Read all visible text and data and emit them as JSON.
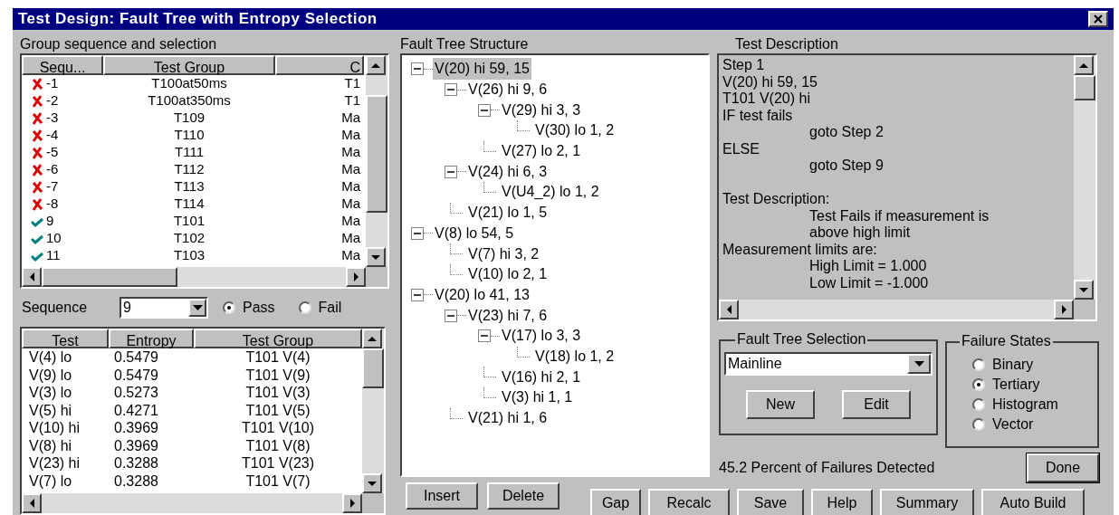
{
  "window": {
    "title": "Test Design: Fault Tree with Entropy Selection"
  },
  "group_panel": {
    "label": "Group sequence and selection",
    "columns": [
      "Sequ...",
      "Test Group",
      "C"
    ],
    "rows": [
      {
        "kind": "fail",
        "sequence": "-1",
        "test_group": "T100at50ms",
        "column_3": "T1",
        "selected": false
      },
      {
        "kind": "fail",
        "sequence": "-2",
        "test_group": "T100at350ms",
        "column_3": "T1",
        "selected": false
      },
      {
        "kind": "fail",
        "sequence": "-3",
        "test_group": "T109",
        "column_3": "Ma",
        "selected": false
      },
      {
        "kind": "fail",
        "sequence": "-4",
        "test_group": "T110",
        "column_3": "Ma",
        "selected": false
      },
      {
        "kind": "fail",
        "sequence": "-5",
        "test_group": "T111",
        "column_3": "Ma",
        "selected": false
      },
      {
        "kind": "fail",
        "sequence": "-6",
        "test_group": "T112",
        "column_3": "Ma",
        "selected": false
      },
      {
        "kind": "fail",
        "sequence": "-7",
        "test_group": "T113",
        "column_3": "Ma",
        "selected": false
      },
      {
        "kind": "fail",
        "sequence": "-8",
        "test_group": "T114",
        "column_3": "Ma",
        "selected": false
      },
      {
        "kind": "pass",
        "sequence": "9",
        "test_group": "T101",
        "column_3": "Ma",
        "selected": false
      },
      {
        "kind": "pass",
        "sequence": "10",
        "test_group": "T102",
        "column_3": "Ma",
        "selected": false
      },
      {
        "kind": "pass",
        "sequence": "11",
        "test_group": "T103",
        "column_3": "Ma",
        "selected": false
      }
    ]
  },
  "sequence": {
    "label": "Sequence",
    "value": "9",
    "options": [
      {
        "label": "Pass",
        "selected": true
      },
      {
        "label": "Fail",
        "selected": false
      }
    ]
  },
  "entropy_table": {
    "columns": [
      "Test",
      "Entropy",
      "Test Group"
    ],
    "rows": [
      {
        "test": "V(4) lo",
        "entropy": "0.5479",
        "test_group": "T101 V(4)"
      },
      {
        "test": "V(9) lo",
        "entropy": "0.5479",
        "test_group": "T101 V(9)"
      },
      {
        "test": "V(3) lo",
        "entropy": "0.5273",
        "test_group": "T101 V(3)"
      },
      {
        "test": "V(5) hi",
        "entropy": "0.4271",
        "test_group": "T101 V(5)"
      },
      {
        "test": "V(10) hi",
        "entropy": "0.3969",
        "test_group": "T101 V(10)"
      },
      {
        "test": "V(8) hi",
        "entropy": "0.3969",
        "test_group": "T101 V(8)"
      },
      {
        "test": "V(23) hi",
        "entropy": "0.3288",
        "test_group": "T101 V(23)"
      },
      {
        "test": "V(7) lo",
        "entropy": "0.3288",
        "test_group": "T101 V(7)"
      }
    ]
  },
  "fault_tree": {
    "label": "Fault Tree Structure",
    "nodes": [
      {
        "label": "V(20) hi  59, 15",
        "selected": true,
        "expanded": true,
        "children": [
          {
            "label": "V(26) hi  9, 6",
            "selected": false,
            "expanded": true,
            "children": [
              {
                "label": "V(29) hi  3, 3",
                "selected": false,
                "expanded": true,
                "children": [
                  {
                    "label": "V(30) lo  1, 2",
                    "selected": false
                  }
                ]
              },
              {
                "label": "V(27) lo  2, 1",
                "selected": false
              }
            ]
          },
          {
            "label": "V(24) hi  6, 3",
            "selected": false,
            "expanded": true,
            "children": [
              {
                "label": "V(U4_2) lo  1, 2",
                "selected": false
              }
            ]
          },
          {
            "label": "V(21) lo  1, 5",
            "selected": false
          }
        ]
      },
      {
        "label": "V(8) lo  54, 5",
        "selected": false,
        "expanded": true,
        "children": [
          {
            "label": "V(7) hi  3, 2",
            "selected": false
          },
          {
            "label": "V(10) lo  2, 1",
            "selected": false
          }
        ]
      },
      {
        "label": "V(20) lo  41, 13",
        "selected": false,
        "expanded": true,
        "children": [
          {
            "label": "V(23) hi  7, 6",
            "selected": false,
            "expanded": true,
            "children": [
              {
                "label": "V(17) lo  3, 3",
                "selected": false,
                "expanded": true,
                "children": [
                  {
                    "label": "V(18) lo  1, 2",
                    "selected": false
                  }
                ]
              },
              {
                "label": "V(16) hi  2, 1",
                "selected": false
              },
              {
                "label": "V(3) hi  1, 1",
                "selected": false
              }
            ]
          },
          {
            "label": "V(21) hi  1, 6",
            "selected": false
          }
        ]
      }
    ]
  },
  "tree_buttons": [
    "Insert",
    "Delete"
  ],
  "description": {
    "label": "Test Description",
    "lines": [
      {
        "text": "Step 1",
        "indented": false,
        "space_before": false
      },
      {
        "text": "V(20) hi  59, 15",
        "indented": false,
        "space_before": false
      },
      {
        "text": "T101 V(20) hi",
        "indented": false,
        "space_before": false
      },
      {
        "text": "IF test fails",
        "indented": false,
        "space_before": false
      },
      {
        "text": "goto Step 2",
        "indented": true,
        "space_before": false
      },
      {
        "text": "ELSE",
        "indented": false,
        "space_before": false
      },
      {
        "text": "goto Step 9",
        "indented": true,
        "space_before": false
      },
      {
        "text": "Test Description:",
        "indented": false,
        "space_before": true
      },
      {
        "text": "Test Fails if measurement is",
        "indented": true,
        "space_before": false
      },
      {
        "text": "above high limit",
        "indented": true,
        "space_before": false
      },
      {
        "text": "Measurement limits are:",
        "indented": false,
        "space_before": false
      },
      {
        "text": "High Limit = 1.000",
        "indented": true,
        "space_before": false
      },
      {
        "text": "Low Limit = -1.000",
        "indented": true,
        "space_before": false
      }
    ]
  },
  "fault_tree_selection": {
    "label": "Fault Tree Selection",
    "value": "Mainline",
    "buttons": [
      "New",
      "Edit"
    ]
  },
  "failure_states": {
    "label": "Failure States",
    "options": [
      {
        "label": "Binary",
        "selected": false
      },
      {
        "label": "Tertiary",
        "selected": true
      },
      {
        "label": "Histogram",
        "selected": false
      },
      {
        "label": "Vector",
        "selected": false
      }
    ]
  },
  "summary_text": "45.2 Percent of Failures Detected",
  "done_button": "Done",
  "bottom_buttons": [
    "Gap",
    "Recalc",
    "Save",
    "Help",
    "Summary",
    "Auto Build"
  ]
}
